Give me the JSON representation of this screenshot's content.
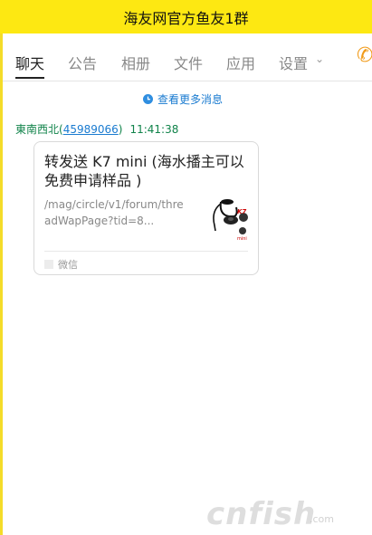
{
  "window": {
    "title": "海友网官方鱼友1群"
  },
  "tabs": [
    {
      "label": "聊天",
      "active": true
    },
    {
      "label": "公告",
      "active": false
    },
    {
      "label": "相册",
      "active": false
    },
    {
      "label": "文件",
      "active": false
    },
    {
      "label": "应用",
      "active": false
    },
    {
      "label": "设置",
      "active": false
    }
  ],
  "chat": {
    "more_messages": "查看更多消息",
    "sender": {
      "name": "東南西北",
      "id": "45989066",
      "time": "11:41:38"
    },
    "card": {
      "title": "转发送 K7 mini (海水播主可以免费申请样品 )",
      "link": "/mag/circle/v1/forum/threadWapPage?tid=8...",
      "source": "微信"
    }
  },
  "watermark": {
    "text": "cnfish",
    "dot": ".com"
  },
  "colors": {
    "titlebar": "#fde812",
    "sender": "#10834a",
    "link": "#1a7bd0",
    "phone": "#f19b1a"
  }
}
